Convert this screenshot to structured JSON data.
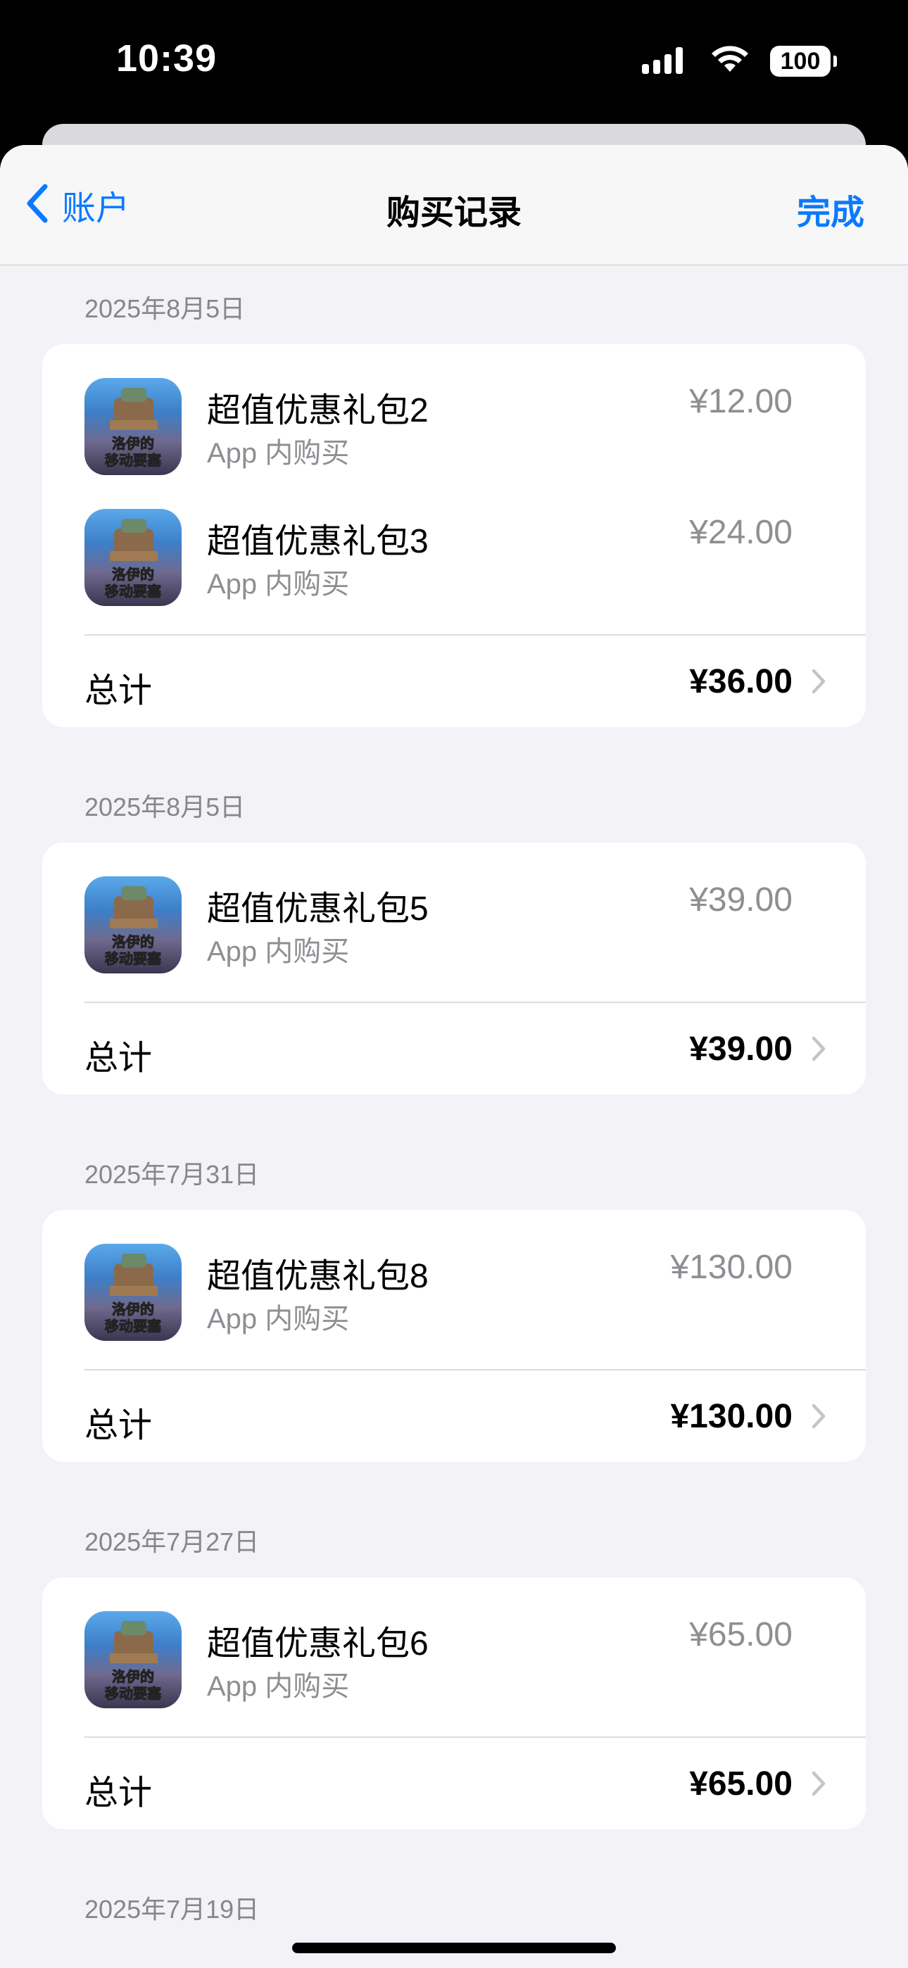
{
  "status_bar": {
    "time": "10:39",
    "battery": "100"
  },
  "nav": {
    "back_label": "账户",
    "title": "购买记录",
    "done_label": "完成"
  },
  "groups": [
    {
      "date": "2025年8月5日",
      "items": [
        {
          "name": "超值优惠礼包2",
          "subtitle": "App 内购买",
          "price": "¥12.00"
        },
        {
          "name": "超值优惠礼包3",
          "subtitle": "App 内购买",
          "price": "¥24.00"
        }
      ],
      "total_label": "总计",
      "total": "¥36.00"
    },
    {
      "date": "2025年8月5日",
      "items": [
        {
          "name": "超值优惠礼包5",
          "subtitle": "App 内购买",
          "price": "¥39.00"
        }
      ],
      "total_label": "总计",
      "total": "¥39.00"
    },
    {
      "date": "2025年7月31日",
      "items": [
        {
          "name": "超值优惠礼包8",
          "subtitle": "App 内购买",
          "price": "¥130.00"
        }
      ],
      "total_label": "总计",
      "total": "¥130.00"
    },
    {
      "date": "2025年7月27日",
      "items": [
        {
          "name": "超值优惠礼包6",
          "subtitle": "App 内购买",
          "price": "¥65.00"
        }
      ],
      "total_label": "总计",
      "total": "¥65.00"
    },
    {
      "date": "2025年7月19日",
      "items": [],
      "total_label": "",
      "total": ""
    }
  ],
  "app_icon": {
    "lines": [
      "洛伊的",
      "移动要塞"
    ]
  },
  "colors": {
    "accent": "#0a7aff",
    "secondary_text": "#8e8e93",
    "background": "#f2f2f7"
  }
}
